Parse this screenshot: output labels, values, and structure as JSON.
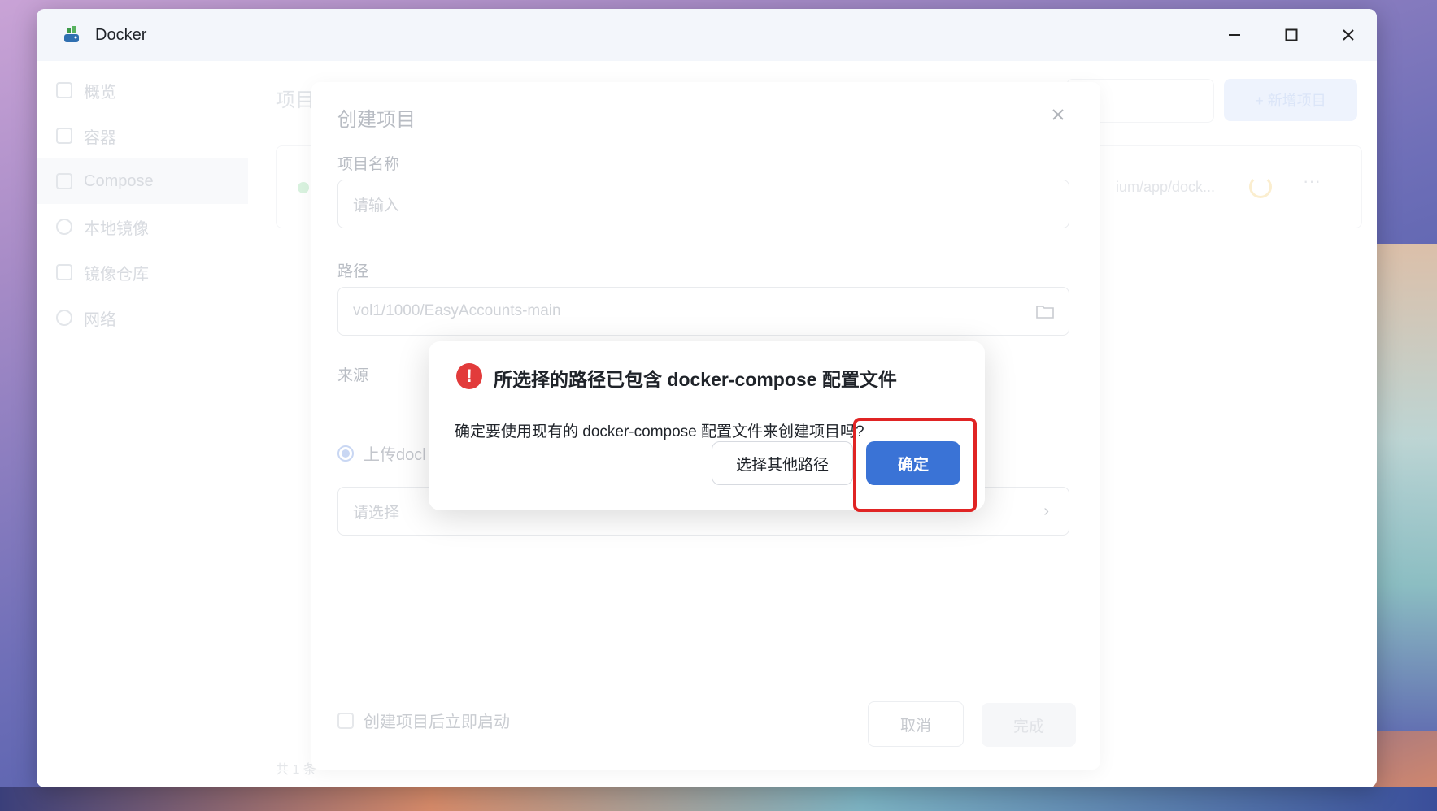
{
  "app": {
    "title": "Docker",
    "icon": "docker-whale-icon"
  },
  "window_controls": {
    "minimize_icon": "minimize-icon",
    "maximize_icon": "maximize-icon",
    "close_icon": "close-icon"
  },
  "sidebar": {
    "items": [
      {
        "label": "概览",
        "icon": "grid-icon"
      },
      {
        "label": "容器",
        "icon": "cube-icon"
      },
      {
        "label": "Compose",
        "icon": "layers-icon",
        "active": true
      },
      {
        "label": "本地镜像",
        "icon": "disc-icon"
      },
      {
        "label": "镜像仓库",
        "icon": "home-icon"
      },
      {
        "label": "网络",
        "icon": "globe-icon"
      }
    ]
  },
  "main": {
    "title": "项目",
    "new_button": "+ 新增项目",
    "project_path": "ium/app/dock...",
    "footer_count": "共 1 条"
  },
  "create_dialog": {
    "title": "创建项目",
    "name_label": "项目名称",
    "name_placeholder": "请输入",
    "path_label": "路径",
    "path_value": "vol1/1000/EasyAccounts-main",
    "source_label": "来源",
    "source_option": "上传docl",
    "select_placeholder": "请选择",
    "autostart_label": "创建项目后立即启动",
    "cancel": "取消",
    "done": "完成"
  },
  "confirm_dialog": {
    "title": "所选择的路径已包含 docker-compose 配置文件",
    "message": "确定要使用现有的 docker-compose 配置文件来创建项目吗?",
    "secondary_button": "选择其他路径",
    "primary_button": "确定",
    "accent": "#3a73d6",
    "warning_color": "#e23b3b"
  }
}
